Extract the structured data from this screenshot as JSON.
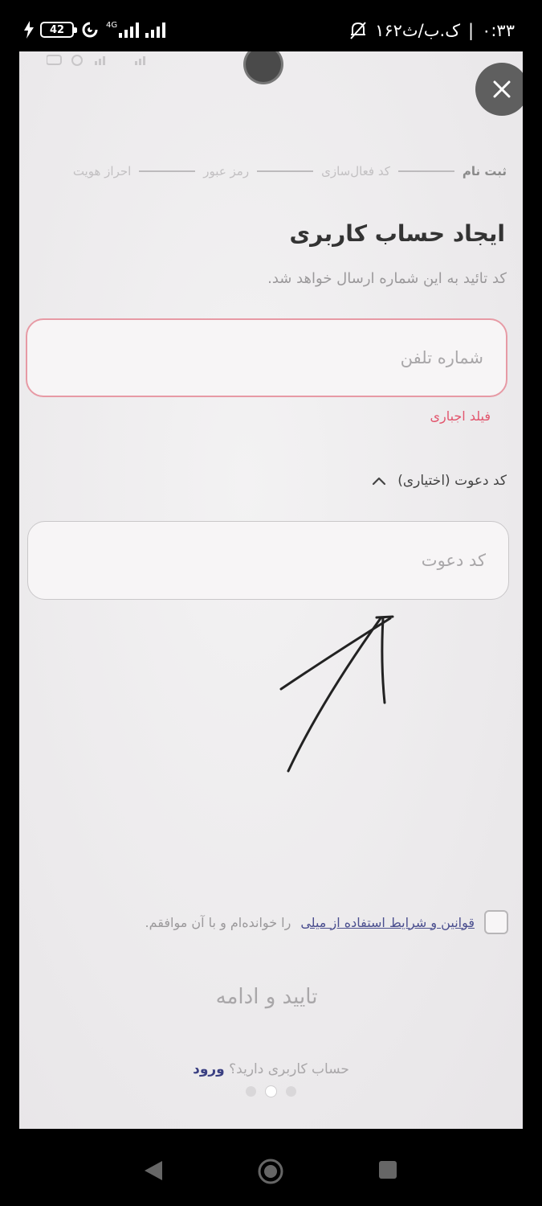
{
  "status_bar": {
    "battery": "42",
    "network_label": "4G",
    "time": "۰:۳۳",
    "data_rate": "۱۶۲ک.ب/ث",
    "icons": [
      "bolt-icon",
      "battery-icon",
      "hotspot-icon",
      "signal-icon",
      "signal-icon",
      "bell-off-icon"
    ]
  },
  "stepper": {
    "steps": [
      "ثبت نام",
      "کد فعال‌سازی",
      "رمز عبور",
      "احراز هویت"
    ]
  },
  "form": {
    "title": "ایجاد حساب کاربری",
    "subtitle": "کد تائید به این شماره ارسال خواهد شد.",
    "phone_placeholder": "شماره تلفن",
    "phone_error": "فیلد اجباری",
    "invite_toggle_label": "کد دعوت (اختیاری)",
    "invite_placeholder": "کد دعوت",
    "terms_link": "قوانین و شرایط استفاده از میلی",
    "terms_rest": "را خوانده‌ام و با آن موافقم.",
    "submit_label": "تایید و ادامه",
    "login_question": "حساب کاربری دارید؟",
    "login_link": "ورود"
  },
  "pager": {
    "count": 3,
    "active_index": 1
  },
  "colors": {
    "error": "#e2566e",
    "error_border": "#e79aa5",
    "link": "#3a3f82",
    "close_button": "#5f5f5f"
  }
}
